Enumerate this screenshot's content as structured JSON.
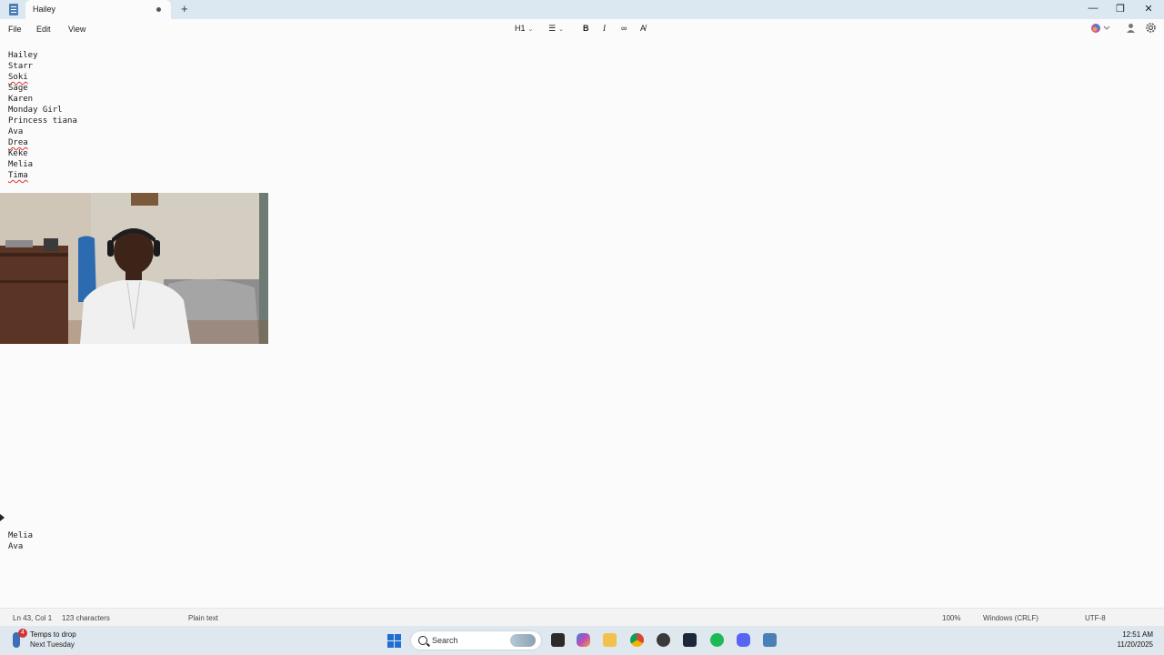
{
  "window": {
    "tab_title": "Hailey",
    "new_tab": "+",
    "minimize": "—",
    "maximize": "❒",
    "close": "✕"
  },
  "menu": {
    "file": "File",
    "edit": "Edit",
    "view": "View"
  },
  "toolbar": {
    "heading": "H1",
    "list": "☰",
    "bold": "B",
    "italic": "I",
    "link": "∞",
    "clear_format": "A̸"
  },
  "document": {
    "lines": [
      "Hailey",
      "Starr",
      "Soki",
      "Sage",
      "Karen",
      "Monday Girl",
      "Princess tiana",
      "Ava",
      "Drea",
      "Keke",
      "Melia",
      "Tima"
    ],
    "bottom_lines": [
      "Melia",
      "Ava"
    ]
  },
  "status": {
    "position": "Ln 43, Col 1",
    "characters": "123 characters",
    "format": "Plain text",
    "zoom": "100%",
    "line_ending": "Windows (CRLF)",
    "encoding": "UTF-8"
  },
  "taskbar": {
    "weather_badge": "4",
    "weather_title": "Temps to drop",
    "weather_sub": "Next Tuesday",
    "search_label": "Search",
    "time": "12:51 AM",
    "date": "11/20/2025"
  },
  "colors": {
    "accent": "#1f6fd1",
    "titlebar": "#dce8f1",
    "spellcheck": "#d93030"
  }
}
